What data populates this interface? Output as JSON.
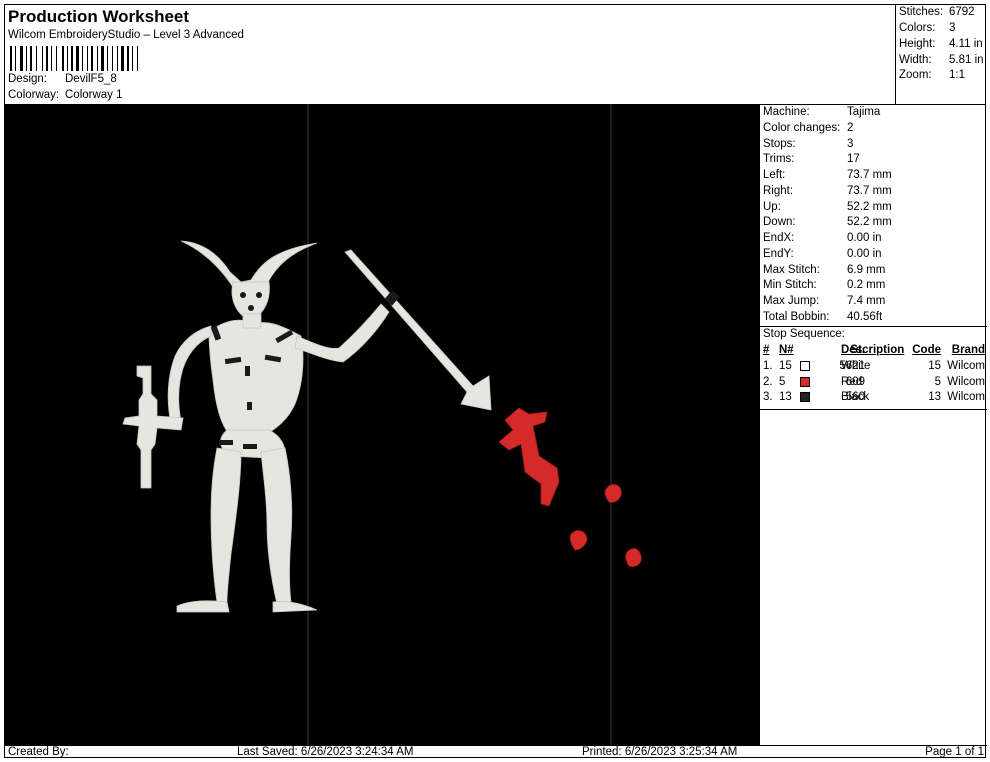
{
  "header": {
    "title": "Production Worksheet",
    "subtitle": "Wilcom EmbroideryStudio – Level 3 Advanced",
    "design_label": "Design:",
    "design_value": "DevilF5_8",
    "colorway_label": "Colorway:",
    "colorway_value": "Colorway 1"
  },
  "stats": [
    {
      "label": "Stitches:",
      "value": "6792"
    },
    {
      "label": "Colors:",
      "value": "3"
    },
    {
      "label": "Height:",
      "value": "4.11 in"
    },
    {
      "label": "Width:",
      "value": "5.81 in"
    },
    {
      "label": "Zoom:",
      "value": "1:1"
    }
  ],
  "machine_info": [
    {
      "label": "Machine:",
      "value": "Tajima"
    },
    {
      "label": "Color changes:",
      "value": "2"
    },
    {
      "label": "Stops:",
      "value": "3"
    },
    {
      "label": "Trims:",
      "value": "17"
    },
    {
      "label": "Left:",
      "value": "73.7 mm"
    },
    {
      "label": "Right:",
      "value": "73.7 mm"
    },
    {
      "label": "Up:",
      "value": "52.2 mm"
    },
    {
      "label": "Down:",
      "value": "52.2 mm"
    },
    {
      "label": "EndX:",
      "value": "0.00 in"
    },
    {
      "label": "EndY:",
      "value": "0.00 in"
    },
    {
      "label": "Max Stitch:",
      "value": "6.9 mm"
    },
    {
      "label": "Min Stitch:",
      "value": "0.2 mm"
    },
    {
      "label": "Max Jump:",
      "value": "7.4 mm"
    },
    {
      "label": "Total Bobbin:",
      "value": "40.56ft"
    }
  ],
  "stop_sequence": {
    "title": "Stop Sequence:",
    "headers": {
      "num": "#",
      "n": "N#",
      "st": "St.",
      "desc": "Description",
      "code": "Code",
      "brand": "Brand"
    },
    "rows": [
      {
        "num": "1.",
        "n": "15",
        "color": "#ffffff",
        "st": "5621",
        "desc": "White",
        "code": "15",
        "brand": "Wilcom"
      },
      {
        "num": "2.",
        "n": "5",
        "color": "#d42a2a",
        "st": "609",
        "desc": "Red",
        "code": "5",
        "brand": "Wilcom"
      },
      {
        "num": "3.",
        "n": "13",
        "color": "#222222",
        "st": "560",
        "desc": "Black",
        "code": "13",
        "brand": "Wilcom"
      }
    ]
  },
  "footer": {
    "created": "Created By:",
    "saved": "Last Saved: 6/26/2023 3:24:34 AM",
    "printed": "Printed: 6/26/2023 3:25:34 AM",
    "page": "Page 1 of 1"
  },
  "colors": {
    "background": "#000000",
    "thread_white": "#e6e6e0",
    "thread_red": "#d42a2a"
  }
}
